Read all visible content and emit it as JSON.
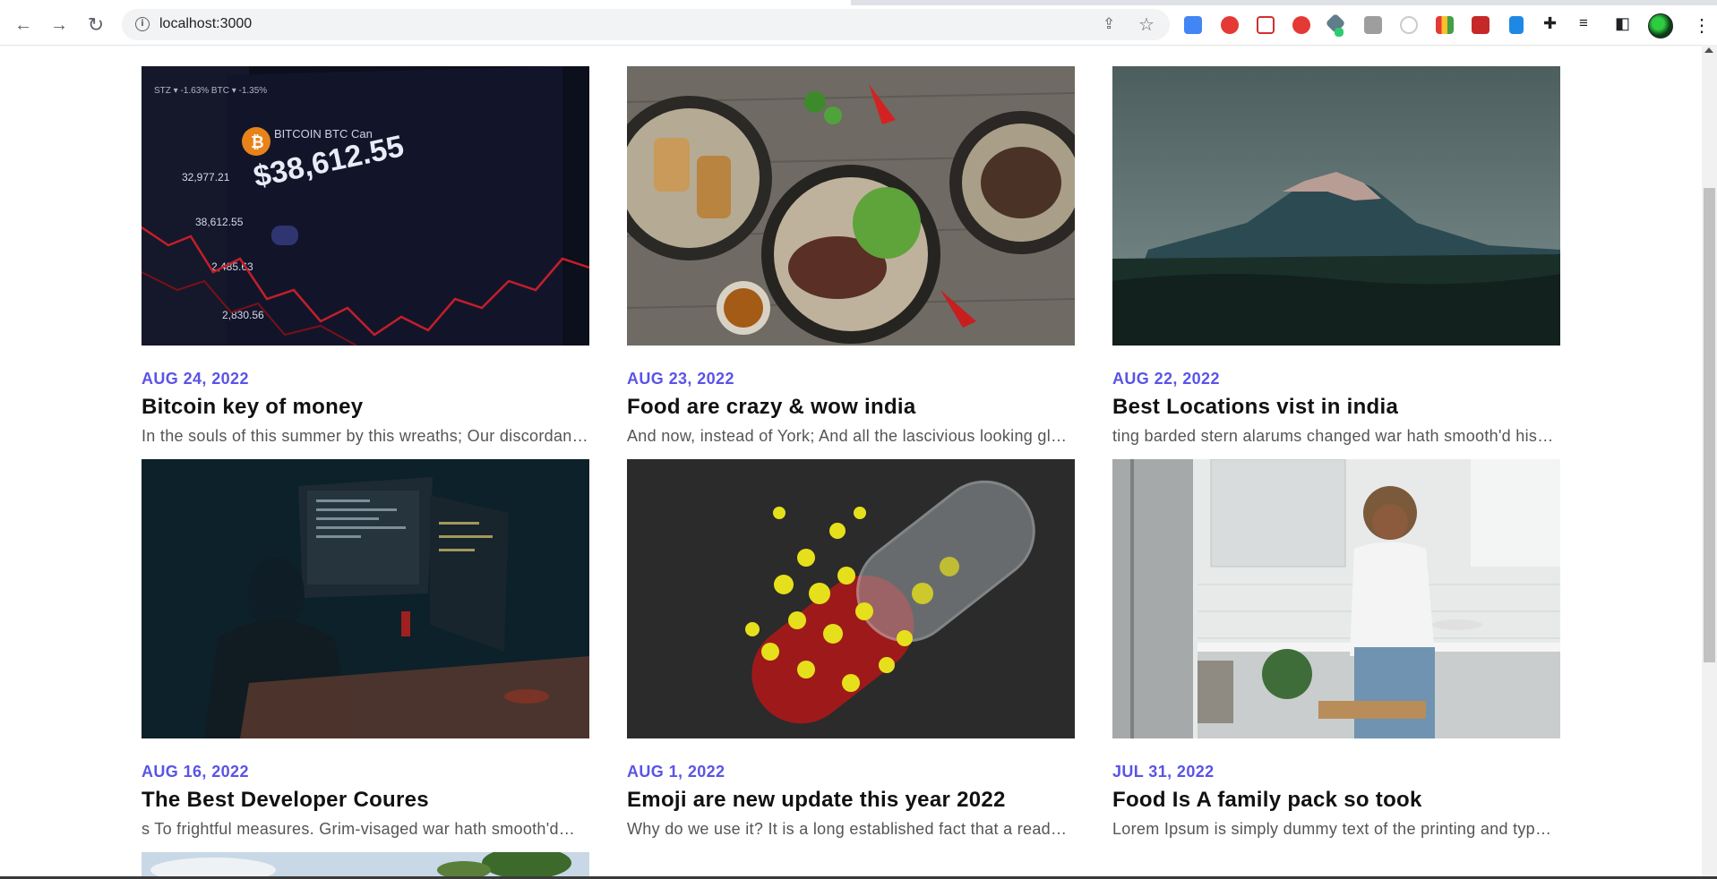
{
  "browser": {
    "url": "localhost:3000",
    "back_icon": "arrow-left-icon",
    "forward_icon": "arrow-right-icon",
    "reload_icon": "reload-icon"
  },
  "posts": [
    {
      "date": "AUG 24, 2022",
      "title": "Bitcoin key of money",
      "excerpt": "In the souls of this summer by this wreaths; Our discordant…",
      "image": "bitcoin-chart-image"
    },
    {
      "date": "AUG 23, 2022",
      "title": "Food are crazy & wow india",
      "excerpt": "And now, instead of York; And all the lascivious looking glass…",
      "image": "food-plates-image"
    },
    {
      "date": "AUG 22, 2022",
      "title": "Best Locations vist in india",
      "excerpt": "ting barded stern alarums changed war hath smooth'd his…",
      "image": "mountain-image"
    },
    {
      "date": "AUG 16, 2022",
      "title": "The Best Developer Coures",
      "excerpt": "s To frightful measures. Grim-visaged war hath smooth'd…",
      "image": "developer-desk-image"
    },
    {
      "date": "AUG 1, 2022",
      "title": "Emoji are new update this year 2022",
      "excerpt": "Why do we use it? It is a long established fact that a reader…",
      "image": "emoji-pill-image"
    },
    {
      "date": "JUL 31, 2022",
      "title": "Food Is A family pack so took",
      "excerpt": "Lorem Ipsum is simply dummy text of the printing and type…",
      "image": "kitchen-woman-image"
    }
  ],
  "colors": {
    "date_accent": "#5a54e6",
    "title": "#111111",
    "excerpt": "#555555"
  }
}
